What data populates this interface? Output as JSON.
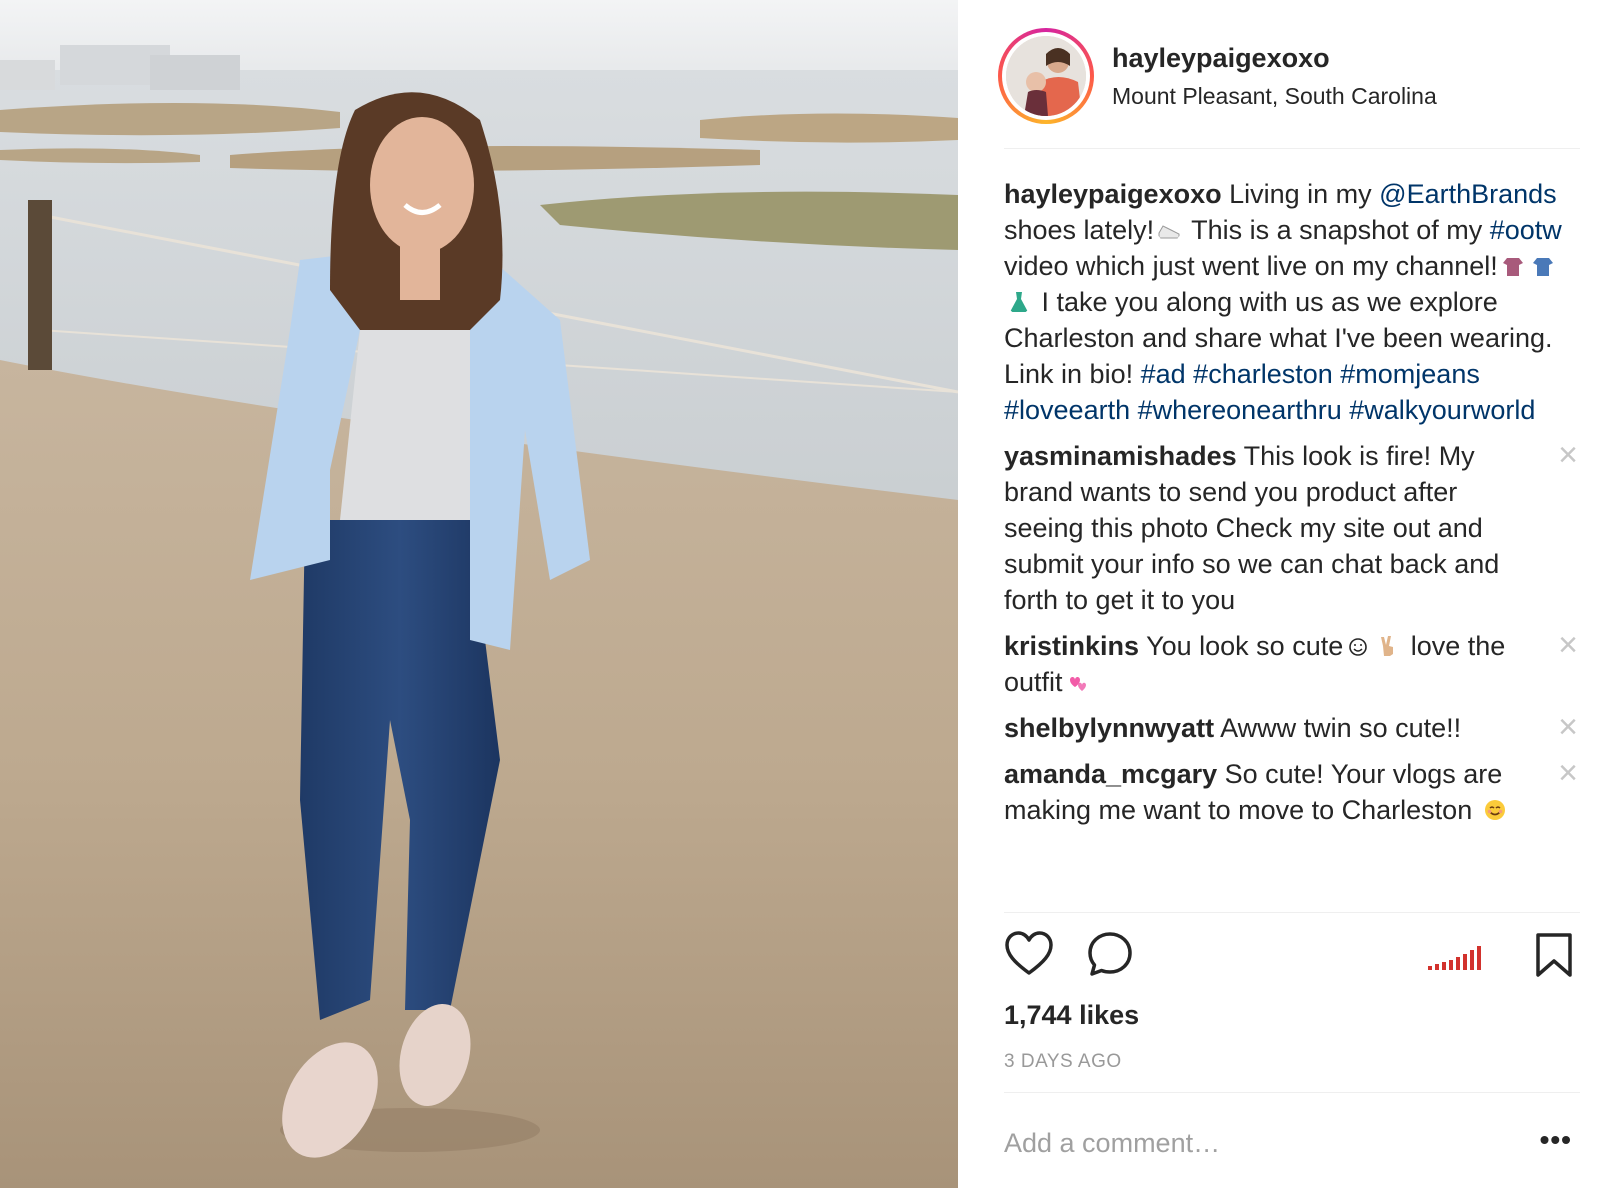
{
  "post": {
    "username": "hayleypaigexoxo",
    "location": "Mount Pleasant, South Carolina"
  },
  "caption": {
    "username": "hayleypaigexoxo",
    "text_1": " Living in my ",
    "mention": "@EarthBrands",
    "text_2": " shoes lately!",
    "text_3": " This is a snapshot of my ",
    "hashtag_1": "#ootw",
    "text_4": " video which just went live on my channel!",
    "text_5": " I take you along with us as we explore Charleston and share what I've been wearing. Link in bio! ",
    "hashtags": [
      "#ad",
      "#charleston",
      "#momjeans",
      "#loveearth",
      "#whereonearthru",
      "#walkyourworld"
    ]
  },
  "comments": [
    {
      "username": "yasminamishades",
      "text": " This look is fire! My brand wants to send you product after seeing this photo Check my site out and submit your info so we can chat back and forth to get it to you"
    },
    {
      "username": "kristinkins",
      "text_a": " You look so cute",
      "text_b": " love the outfit"
    },
    {
      "username": "shelbylynnwyatt",
      "text": " Awww twin so cute!!"
    },
    {
      "username": "amanda_mcgary",
      "text": " So cute! Your vlogs are making me want to move to Charleston"
    }
  ],
  "icons": {
    "close": "×",
    "heart": "heart-icon",
    "comment": "comment-bubble-icon",
    "signal": "signal-bars-icon",
    "bookmark": "bookmark-icon"
  },
  "likes": "1,744 likes",
  "time_ago": "3 DAYS AGO",
  "add_comment_placeholder": "Add a comment…",
  "more_label": "•••",
  "colors": {
    "link": "#003569",
    "text": "#262626",
    "muted": "#999999",
    "signal": "#d2322d"
  }
}
